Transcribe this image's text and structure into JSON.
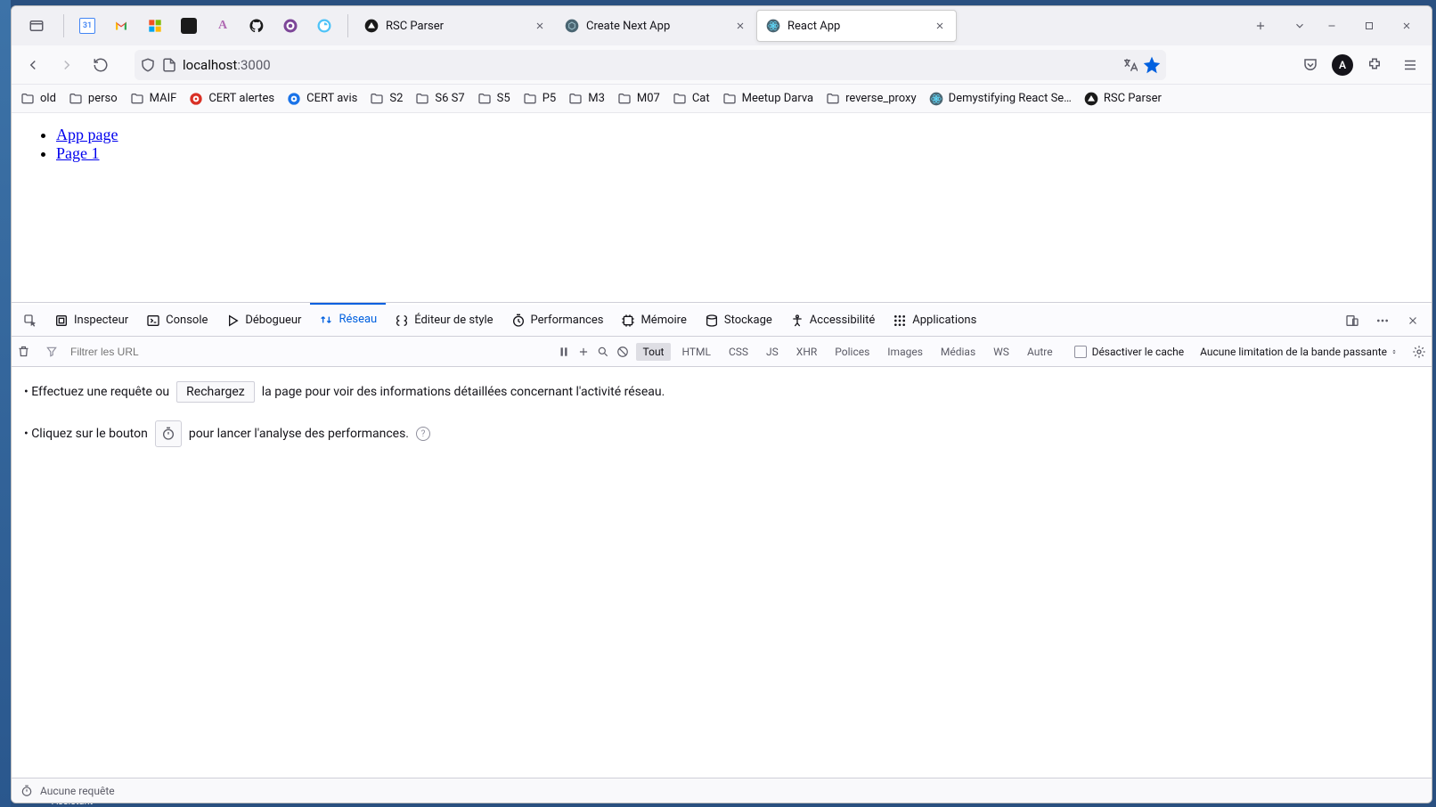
{
  "pinned_tabs": [
    "calendar",
    "gmail",
    "microsoft",
    "code",
    "a-logo",
    "github",
    "onion",
    "browser-tools"
  ],
  "tabs": [
    {
      "label": "RSC Parser",
      "favicon": "triangle-dark",
      "active": false,
      "closeable": true
    },
    {
      "label": "Create Next App",
      "favicon": "next",
      "active": false,
      "closeable": true
    },
    {
      "label": "React App",
      "favicon": "react",
      "active": true,
      "closeable": true
    }
  ],
  "url": {
    "host": "localhost",
    "port": ":3000"
  },
  "bookmarks": [
    {
      "icon": "folder",
      "label": "old"
    },
    {
      "icon": "folder",
      "label": "perso"
    },
    {
      "icon": "folder",
      "label": "MAIF"
    },
    {
      "icon": "cert-r",
      "label": "CERT alertes"
    },
    {
      "icon": "cert-b",
      "label": "CERT avis"
    },
    {
      "icon": "folder",
      "label": "S2"
    },
    {
      "icon": "folder",
      "label": "S6 S7"
    },
    {
      "icon": "folder",
      "label": "S5"
    },
    {
      "icon": "folder",
      "label": "P5"
    },
    {
      "icon": "folder",
      "label": "M3"
    },
    {
      "icon": "folder",
      "label": "M07"
    },
    {
      "icon": "folder",
      "label": "Cat"
    },
    {
      "icon": "folder",
      "label": "Meetup Darva"
    },
    {
      "icon": "folder",
      "label": "reverse_proxy"
    },
    {
      "icon": "react",
      "label": "Demystifying React Se…"
    },
    {
      "icon": "triangle-dark",
      "label": "RSC Parser"
    }
  ],
  "page": {
    "links": [
      "App page",
      "Page 1"
    ]
  },
  "devtools": {
    "tabs": [
      {
        "id": "inspector",
        "label": "Inspecteur"
      },
      {
        "id": "console",
        "label": "Console"
      },
      {
        "id": "debugger",
        "label": "Débogueur"
      },
      {
        "id": "network",
        "label": "Réseau",
        "active": true
      },
      {
        "id": "style",
        "label": "Éditeur de style"
      },
      {
        "id": "perf",
        "label": "Performances"
      },
      {
        "id": "memory",
        "label": "Mémoire"
      },
      {
        "id": "storage",
        "label": "Stockage"
      },
      {
        "id": "a11y",
        "label": "Accessibilité"
      },
      {
        "id": "apps",
        "label": "Applications"
      }
    ],
    "filter_placeholder": "Filtrer les URL",
    "chips": [
      "Tout",
      "HTML",
      "CSS",
      "JS",
      "XHR",
      "Polices",
      "Images",
      "Médias",
      "WS",
      "Autre"
    ],
    "selected_chip": "Tout",
    "disable_cache_label": "Désactiver le cache",
    "throttle_label": "Aucune limitation de la bande passante",
    "hint1_pre": "• Effectuez une requête ou",
    "hint1_btn": "Rechargez",
    "hint1_post": "la page pour voir des informations détaillées concernant l'activité réseau.",
    "hint2_pre": "• Cliquez sur le bouton",
    "hint2_post": "pour lancer l'analyse des performances.",
    "status": "Aucune requête"
  },
  "taskbar_hint": "Assistant"
}
